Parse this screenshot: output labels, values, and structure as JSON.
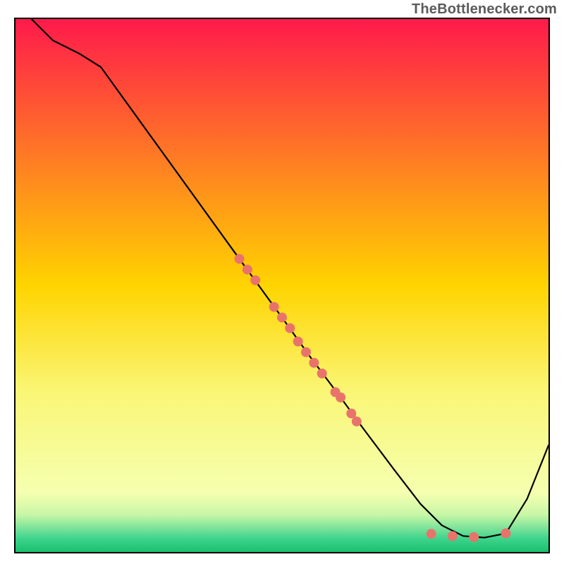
{
  "watermark": "TheBottlenecker.com",
  "chart_data": {
    "type": "line",
    "title": "",
    "xlabel": "",
    "ylabel": "",
    "xlim": [
      0,
      100
    ],
    "ylim": [
      0,
      100
    ],
    "grid": false,
    "legend": false,
    "background_gradient": {
      "stops": [
        {
          "offset": 0.0,
          "color": "#ff1a4b"
        },
        {
          "offset": 0.5,
          "color": "#ffd400"
        },
        {
          "offset": 0.7,
          "color": "#faf676"
        },
        {
          "offset": 0.89,
          "color": "#f5ffb0"
        },
        {
          "offset": 0.93,
          "color": "#c7f7a6"
        },
        {
          "offset": 0.955,
          "color": "#7de39a"
        },
        {
          "offset": 0.975,
          "color": "#3dd48c"
        },
        {
          "offset": 1.0,
          "color": "#19c06f"
        }
      ]
    },
    "series": [
      {
        "name": "curve",
        "color": "#000000",
        "width": 2.2,
        "x": [
          3,
          7,
          12,
          16,
          42,
          46,
          50,
          55,
          58,
          61,
          65,
          71,
          76,
          80,
          84,
          88,
          92,
          96,
          100
        ],
        "y": [
          100,
          96,
          93.5,
          91,
          55,
          49.5,
          44,
          37,
          33,
          29,
          23.5,
          15.5,
          9,
          5,
          3,
          2.7,
          3.5,
          10,
          20
        ]
      }
    ],
    "points": {
      "color": "#e9736b",
      "radius": 7,
      "items": [
        {
          "x": 42,
          "y": 55
        },
        {
          "x": 43.5,
          "y": 53
        },
        {
          "x": 45,
          "y": 51
        },
        {
          "x": 48.5,
          "y": 46
        },
        {
          "x": 50,
          "y": 44
        },
        {
          "x": 51.5,
          "y": 42
        },
        {
          "x": 53,
          "y": 39.5
        },
        {
          "x": 54.5,
          "y": 37.5
        },
        {
          "x": 56,
          "y": 35.5
        },
        {
          "x": 57.5,
          "y": 33.5
        },
        {
          "x": 60,
          "y": 30
        },
        {
          "x": 61,
          "y": 29
        },
        {
          "x": 63,
          "y": 26
        },
        {
          "x": 64,
          "y": 24.5
        },
        {
          "x": 78,
          "y": 3.4
        },
        {
          "x": 82,
          "y": 3.0
        },
        {
          "x": 86,
          "y": 2.8
        },
        {
          "x": 92,
          "y": 3.5
        }
      ]
    }
  }
}
